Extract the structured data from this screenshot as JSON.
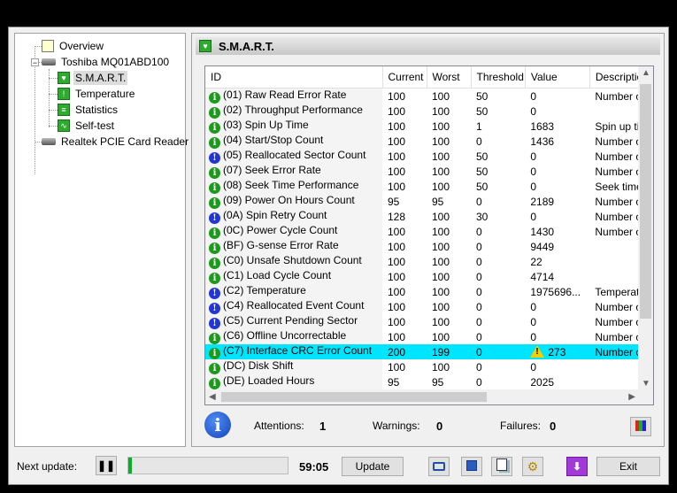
{
  "tree": {
    "overview": "Overview",
    "drive": "Toshiba MQ01ABD100",
    "smart": "S.M.A.R.T.",
    "temperature": "Temperature",
    "statistics": "Statistics",
    "selftest": "Self-test",
    "reader": "Realtek PCIE Card Reader"
  },
  "panel": {
    "title": "S.M.A.R.T."
  },
  "table": {
    "columns": [
      "ID",
      "Current",
      "Worst",
      "Threshold",
      "Value",
      "Description"
    ],
    "rows": [
      {
        "status": "good",
        "id": "(01) Raw Read Error Rate",
        "cur": "100",
        "worst": "100",
        "thr": "50",
        "val": "0",
        "desc": "Number of"
      },
      {
        "status": "good",
        "id": "(02) Throughput Performance",
        "cur": "100",
        "worst": "100",
        "thr": "50",
        "val": "0",
        "desc": ""
      },
      {
        "status": "good",
        "id": "(03) Spin Up Time",
        "cur": "100",
        "worst": "100",
        "thr": "1",
        "val": "1683",
        "desc": "Spin up tim"
      },
      {
        "status": "good",
        "id": "(04) Start/Stop Count",
        "cur": "100",
        "worst": "100",
        "thr": "0",
        "val": "1436",
        "desc": "Number of"
      },
      {
        "status": "warn",
        "id": "(05) Reallocated Sector Count",
        "cur": "100",
        "worst": "100",
        "thr": "50",
        "val": "0",
        "desc": "Number of"
      },
      {
        "status": "good",
        "id": "(07) Seek Error Rate",
        "cur": "100",
        "worst": "100",
        "thr": "50",
        "val": "0",
        "desc": "Number of"
      },
      {
        "status": "good",
        "id": "(08) Seek Time Performance",
        "cur": "100",
        "worst": "100",
        "thr": "50",
        "val": "0",
        "desc": "Seek time p"
      },
      {
        "status": "good",
        "id": "(09) Power On Hours Count",
        "cur": "95",
        "worst": "95",
        "thr": "0",
        "val": "2189",
        "desc": "Number of"
      },
      {
        "status": "warn",
        "id": "(0A) Spin Retry Count",
        "cur": "128",
        "worst": "100",
        "thr": "30",
        "val": "0",
        "desc": "Number of"
      },
      {
        "status": "good",
        "id": "(0C) Power Cycle Count",
        "cur": "100",
        "worst": "100",
        "thr": "0",
        "val": "1430",
        "desc": "Number of"
      },
      {
        "status": "good",
        "id": "(BF) G-sense Error Rate",
        "cur": "100",
        "worst": "100",
        "thr": "0",
        "val": "9449",
        "desc": ""
      },
      {
        "status": "good",
        "id": "(C0) Unsafe Shutdown Count",
        "cur": "100",
        "worst": "100",
        "thr": "0",
        "val": "22",
        "desc": ""
      },
      {
        "status": "good",
        "id": "(C1) Load Cycle Count",
        "cur": "100",
        "worst": "100",
        "thr": "0",
        "val": "4714",
        "desc": ""
      },
      {
        "status": "warn",
        "id": "(C2) Temperature",
        "cur": "100",
        "worst": "100",
        "thr": "0",
        "val": "1975696...",
        "desc": "Temperatur"
      },
      {
        "status": "warn",
        "id": "(C4) Reallocated Event Count",
        "cur": "100",
        "worst": "100",
        "thr": "0",
        "val": "0",
        "desc": "Number of"
      },
      {
        "status": "warn",
        "id": "(C5) Current Pending Sector",
        "cur": "100",
        "worst": "100",
        "thr": "0",
        "val": "0",
        "desc": "Number of"
      },
      {
        "status": "good",
        "id": "(C6) Offline Uncorrectable",
        "cur": "100",
        "worst": "100",
        "thr": "0",
        "val": "0",
        "desc": "Number of"
      },
      {
        "status": "good",
        "id": "(C7) Interface CRC Error Count",
        "cur": "200",
        "worst": "199",
        "thr": "0",
        "val": "273",
        "desc": "Number of",
        "highlight": true,
        "alert": true
      },
      {
        "status": "good",
        "id": "(DC) Disk Shift",
        "cur": "100",
        "worst": "100",
        "thr": "0",
        "val": "0",
        "desc": ""
      },
      {
        "status": "good",
        "id": "(DE) Loaded Hours",
        "cur": "95",
        "worst": "95",
        "thr": "0",
        "val": "2025",
        "desc": ""
      }
    ]
  },
  "summary": {
    "attentions_label": "Attentions:",
    "attentions": "1",
    "warnings_label": "Warnings:",
    "warnings": "0",
    "failures_label": "Failures:",
    "failures": "0"
  },
  "bottom": {
    "next_update_label": "Next update:",
    "timer": "59:05",
    "update_button": "Update",
    "exit_button": "Exit",
    "progress_fraction": 0.02
  }
}
